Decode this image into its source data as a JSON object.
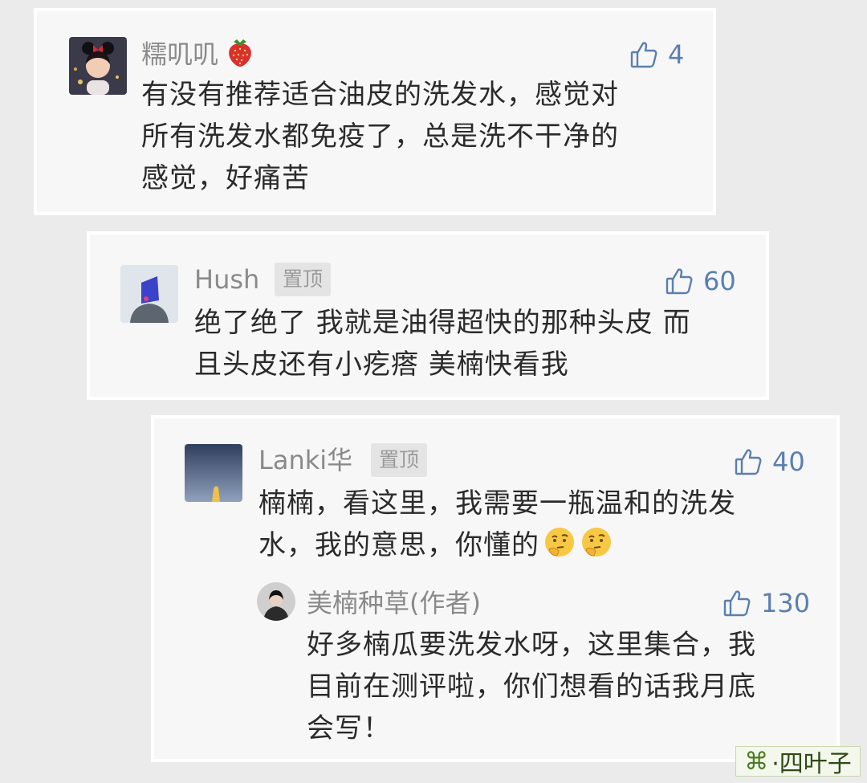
{
  "comments": [
    {
      "user": "糯叽叽",
      "likes": "4",
      "text_lines": [
        "有没有推荐适合油皮的洗发水，感觉对",
        "所有洗发水都免疫了，总是洗不干净的",
        "感觉，好痛苦"
      ]
    },
    {
      "user": "Hush",
      "badge": "置顶",
      "likes": "60",
      "text_lines": [
        "绝了绝了 我就是油得超快的那种头皮 而",
        "且头皮还有小疙瘩 美楠快看我"
      ]
    },
    {
      "user": "Lanki华",
      "badge": "置顶",
      "likes": "40",
      "text_lines": [
        "楠楠，看这里，我需要一瓶温和的洗发",
        "水，我的意思，你懂的"
      ],
      "reply": {
        "user": "美楠种草(作者)",
        "likes": "130",
        "text_lines": [
          "好多楠瓜要洗发水呀，这里集合，我",
          "目前在测评啦，你们想看的话我月底",
          "会写！"
        ]
      }
    }
  ],
  "watermark": {
    "icon": "clover-icon",
    "text": "·四叶子"
  },
  "colors": {
    "like_blue": "#5a7fb0",
    "username_gray": "#8a8a8a",
    "badge_bg": "#e4e4e4"
  }
}
